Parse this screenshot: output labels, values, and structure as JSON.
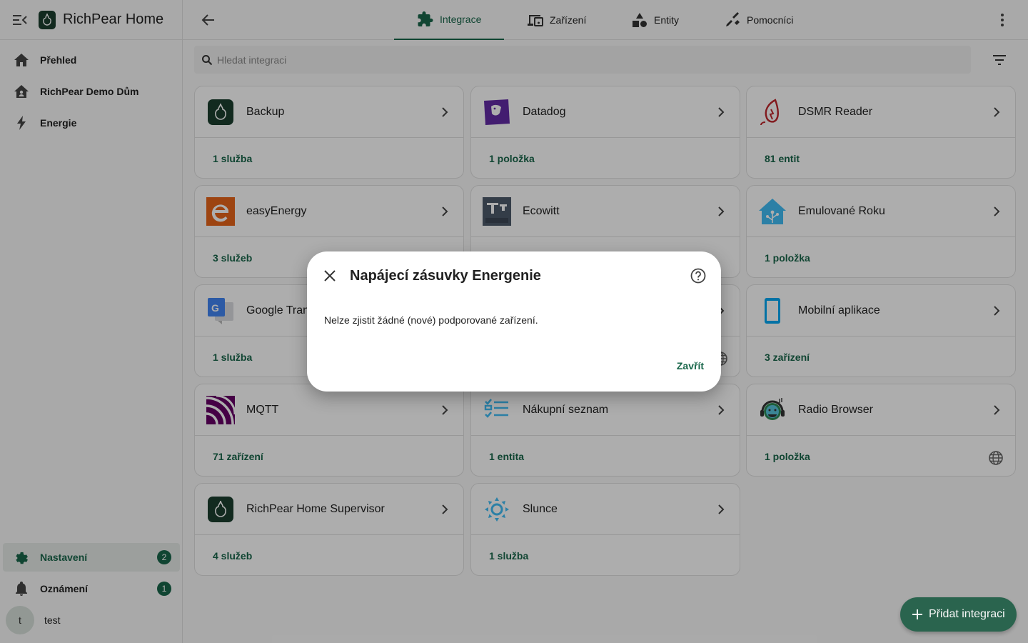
{
  "app": {
    "title": "RichPear Home"
  },
  "sidebar": {
    "items": [
      {
        "label": "Přehled",
        "icon": "home-icon"
      },
      {
        "label": "RichPear Demo Dům",
        "icon": "home-account-icon"
      },
      {
        "label": "Energie",
        "icon": "lightning-icon"
      }
    ],
    "bottom": [
      {
        "label": "Nastavení",
        "icon": "gear-icon",
        "badge": "2"
      },
      {
        "label": "Oznámení",
        "icon": "bell-icon",
        "badge": "1"
      }
    ],
    "user": {
      "initial": "t",
      "name": "test"
    }
  },
  "tabs": [
    {
      "label": "Integrace",
      "icon": "puzzle-icon"
    },
    {
      "label": "Zařízení",
      "icon": "devices-icon"
    },
    {
      "label": "Entity",
      "icon": "shapes-icon"
    },
    {
      "label": "Pomocníci",
      "icon": "tools-icon"
    }
  ],
  "search": {
    "placeholder": "Hledat integraci"
  },
  "cards": [
    {
      "name": "Backup",
      "count": "1 služba"
    },
    {
      "name": "Datadog",
      "count": "1 položka"
    },
    {
      "name": "DSMR Reader",
      "count": "81 entit"
    },
    {
      "name": "easyEnergy",
      "count": "3 služeb"
    },
    {
      "name": "Ecowitt",
      "count": ""
    },
    {
      "name": "Emulované Roku",
      "count": "1 položka"
    },
    {
      "name": "Google Tran",
      "count": "1 služba"
    },
    {
      "name": "Mobilní aplikace",
      "count": "3 zařízení"
    },
    {
      "name": "MQTT",
      "count": "71 zařízení"
    },
    {
      "name": "Nákupní seznam",
      "count": "1 entita"
    },
    {
      "name": "Radio Browser",
      "count": "1 položka"
    },
    {
      "name": "RichPear Home Supervisor",
      "count": "4 služeb"
    },
    {
      "name": "Slunce",
      "count": "1 služba"
    }
  ],
  "fab": {
    "label": "Přidat integraci"
  },
  "dialog": {
    "title": "Napájecí zásuvky Energenie",
    "message": "Nelze zjistit žádné (nové) podporované zařízení.",
    "close_label": "Zavřít"
  },
  "colors": {
    "primary": "#18664a",
    "fab": "#205f47"
  }
}
